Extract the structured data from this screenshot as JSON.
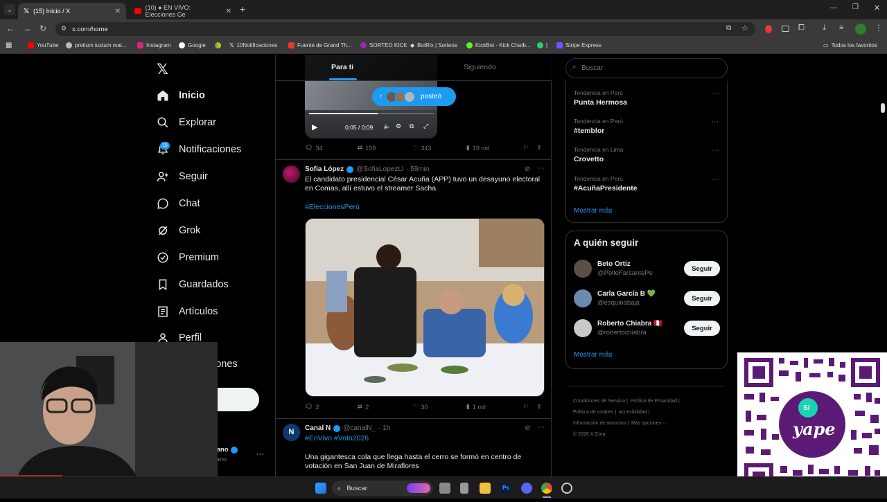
{
  "browser": {
    "tabs": [
      {
        "title": "(15) Inicio / X",
        "active": true
      },
      {
        "title": "(10) ● EN VIVO: Elecciones Ge",
        "active": false
      }
    ],
    "url": "x.com/home",
    "bookmarks": [
      "YouTube",
      "pretium iustum mat...",
      "Instagram",
      "Google",
      "10Notificaciones",
      "Fuente de Grand Th...",
      "SORTEO KICK",
      "BotRix | Sorteos",
      "KickBot - Kick Chatb...",
      "|",
      "Stripe Express"
    ],
    "all_bookmarks": "Todos los favoritos"
  },
  "nav": {
    "items": [
      "Inicio",
      "Explorar",
      "Notificaciones",
      "Seguir",
      "Chat",
      "Grok",
      "Premium",
      "Guardados",
      "Artículos",
      "Perfil",
      "iones"
    ],
    "notif_badge": "15",
    "profile_name": "iano",
    "profile_handle": "iano"
  },
  "feed": {
    "tabs": [
      "Para ti",
      "Siguiendo"
    ],
    "posted_pill": "posteó",
    "video_time": "0:05 / 0:09",
    "post0_actions": {
      "replies": "34",
      "reposts": "159",
      "likes": "343",
      "views": "19 mil"
    },
    "post1": {
      "name": "Sofía López",
      "handle": "@SofiaLopezLl",
      "time": "· 59min",
      "text": "El candidato presidencial César Acuña (APP) tuvo un desayuno electoral en Comas, allí estuvo el streamer Sacha.",
      "hashtag": "#EleccionesPerú",
      "actions": {
        "replies": "2",
        "reposts": "2",
        "likes": "30",
        "views": "1 mil"
      }
    },
    "post2": {
      "name": "Canal N",
      "handle": "@canalN_",
      "time": "· 1h",
      "hashtags": "#EnVivo #Voto2026",
      "text": "Una gigantesca cola que llega hasta el cerro se formó en centro de votación en San Juan de Miraflores"
    }
  },
  "right": {
    "search_placeholder": "Buscar",
    "trends": [
      {
        "context": "Tendencia en Perú",
        "name": "Punta Hermosa"
      },
      {
        "context": "Tendencia en Perú",
        "name": "#temblor"
      },
      {
        "context": "Tendencia en Lima",
        "name": "Crovetto"
      },
      {
        "context": "Tendencia en Perú",
        "name": "#AcuñaPresidente"
      }
    ],
    "show_more": "Mostrar más",
    "who_title": "A quién seguir",
    "who": [
      {
        "name": "Beto Ortiz",
        "handle": "@PolloFarsantePe"
      },
      {
        "name": "Carla García B 💚",
        "handle": "@esquinabaja"
      },
      {
        "name": "Roberto Chiabra 🇵🇪",
        "handle": "@robertochiabra"
      }
    ],
    "follow_label": "Seguir",
    "footer": [
      "Condiciones de Servicio",
      "Política de Privacidad",
      "Política de cookies",
      "Accesibilidad",
      "Información de anuncios",
      "Más opciones ···",
      "© 2026 X Corp."
    ]
  },
  "taskbar": {
    "search": "Buscar"
  },
  "qr": {
    "brand": "yape",
    "symbol": "S/"
  }
}
